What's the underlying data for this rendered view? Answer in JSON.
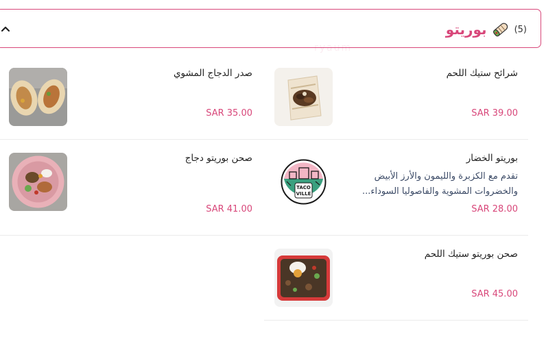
{
  "category": {
    "title": "بوريتو",
    "count": "(5)",
    "icon": "burrito-icon",
    "collapse_icon": "chevron-up-icon"
  },
  "watermark": "ryaum",
  "items": [
    {
      "name": "شرائح ستيك اللحم",
      "price": "SAR 39.00"
    },
    {
      "name": "صدر الدجاج المشوي",
      "price": "SAR 35.00"
    },
    {
      "name": "بوريتو الخضار",
      "description": "تقدم مع الكزبرة والليمون والأرز الأبيض والخضروات المشوية والفاصوليا السوداء...",
      "price": "SAR 28.00",
      "logo_text_1": "TACO",
      "logo_text_2": "VILLE"
    },
    {
      "name": "صحن بوريتو دجاج",
      "price": "SAR 41.00"
    },
    {
      "name": "صحن بوريتو ستيك اللحم",
      "price": "SAR 45.00"
    }
  ],
  "colors": {
    "accent": "#d8477a",
    "description": "#3b4a66",
    "divider": "#ebebeb"
  }
}
